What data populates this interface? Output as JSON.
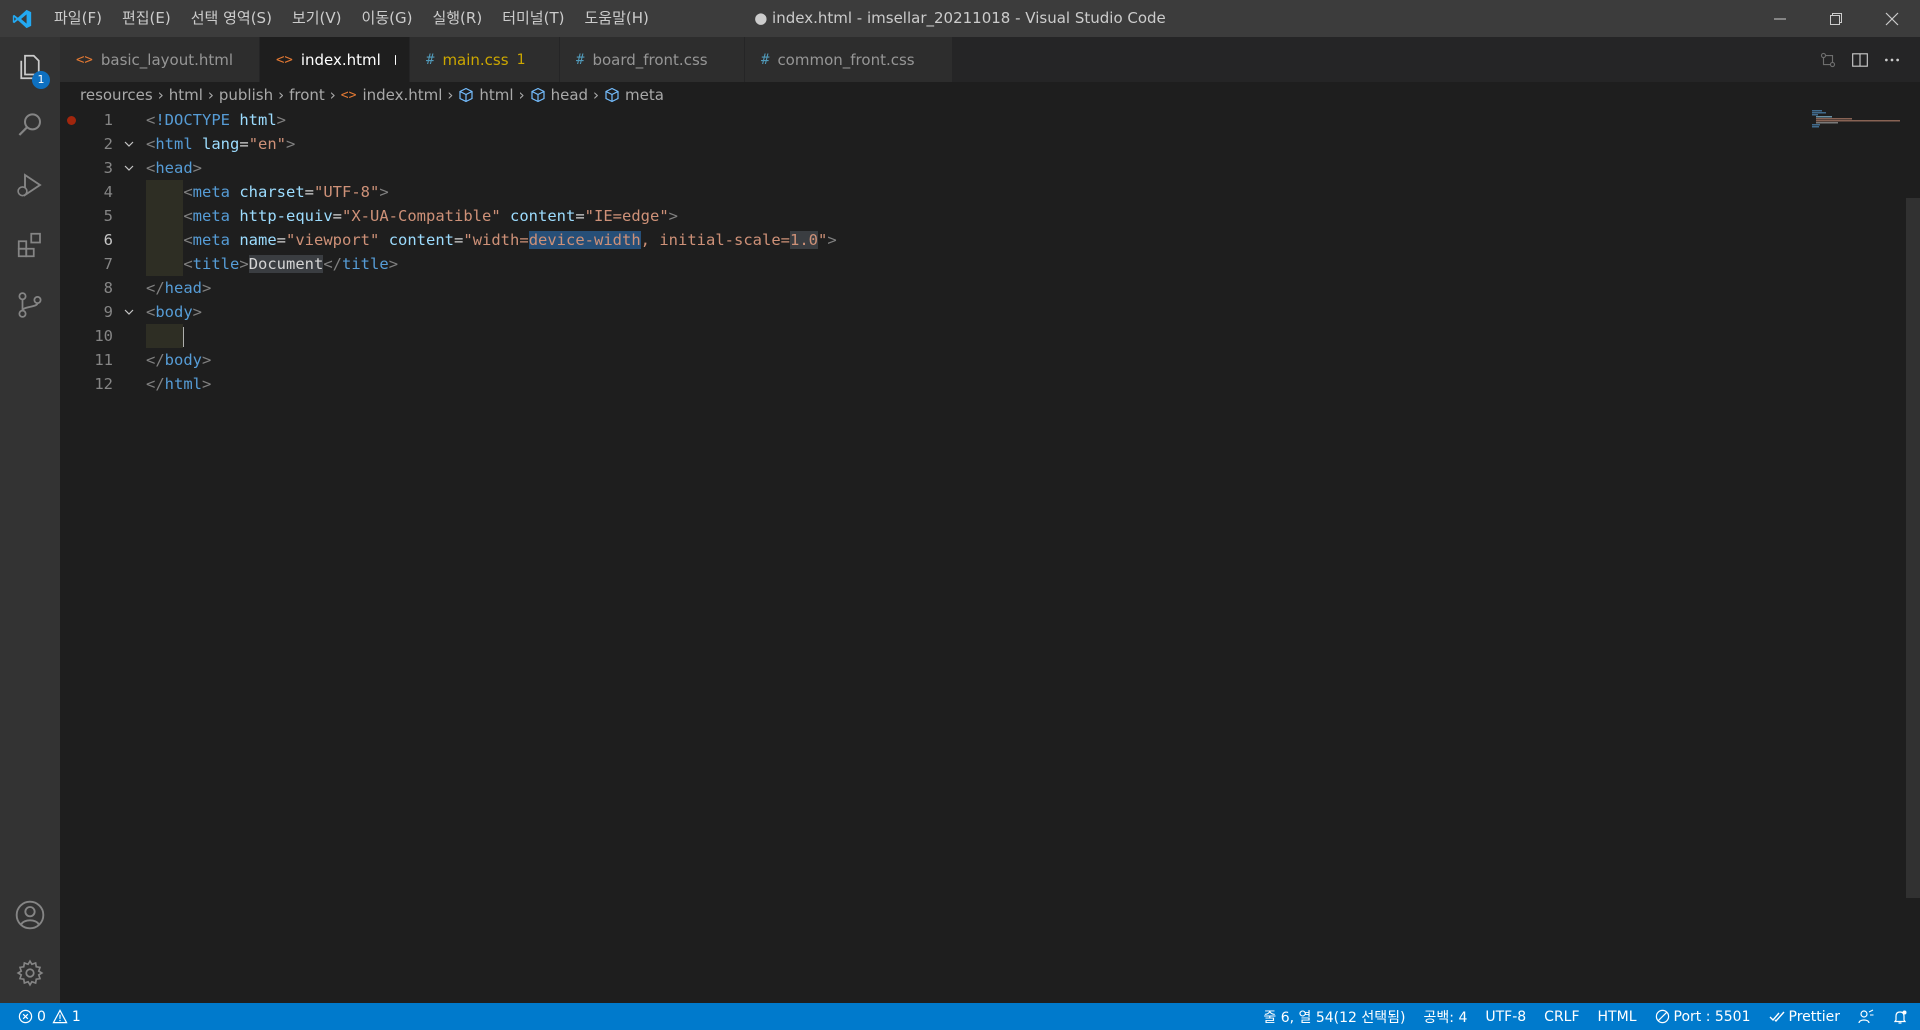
{
  "app": {
    "window_title": "● index.html - imsellar_20211018 - Visual Studio Code",
    "accent": "#007acc",
    "menu": [
      "파일(F)",
      "편집(E)",
      "선택 영역(S)",
      "보기(V)",
      "이동(G)",
      "실행(R)",
      "터미널(T)",
      "도움말(H)"
    ]
  },
  "activity_bar": {
    "explorer_badge": "1",
    "items": [
      "explorer-icon",
      "search-icon",
      "run-debug-icon",
      "extensions-icon",
      "source-control-icon"
    ],
    "bottom": [
      "account-icon",
      "gear-icon"
    ]
  },
  "tabs": [
    {
      "label": "basic_layout.html",
      "icon": "<>",
      "icon_color": "#e37933",
      "active": false
    },
    {
      "label": "index.html",
      "icon": "<>",
      "icon_color": "#e37933",
      "active": true,
      "dirty": true
    },
    {
      "label": "main.css",
      "icon": "#",
      "icon_color": "#519aba",
      "active": false,
      "problems": "1",
      "label_color": "#cca700"
    },
    {
      "label": "board_front.css",
      "icon": "#",
      "icon_color": "#519aba",
      "active": false
    },
    {
      "label": "common_front.css",
      "icon": "#",
      "icon_color": "#519aba",
      "active": false
    }
  ],
  "breadcrumb": [
    "resources",
    "html",
    "publish",
    "front",
    "index.html",
    "html",
    "head",
    "meta"
  ],
  "editor": {
    "lines": [
      "1",
      "2",
      "3",
      "4",
      "5",
      "6",
      "7",
      "8",
      "9",
      "10",
      "11",
      "12"
    ],
    "current_line": "6"
  },
  "status": {
    "errors": "0",
    "warnings": "1",
    "position": "줄 6, 열 54(12 선택됨)",
    "spaces": "공백: 4",
    "encoding": "UTF-8",
    "eol": "CRLF",
    "language": "HTML",
    "port": "Port : 5501",
    "prettier": "Prettier"
  }
}
